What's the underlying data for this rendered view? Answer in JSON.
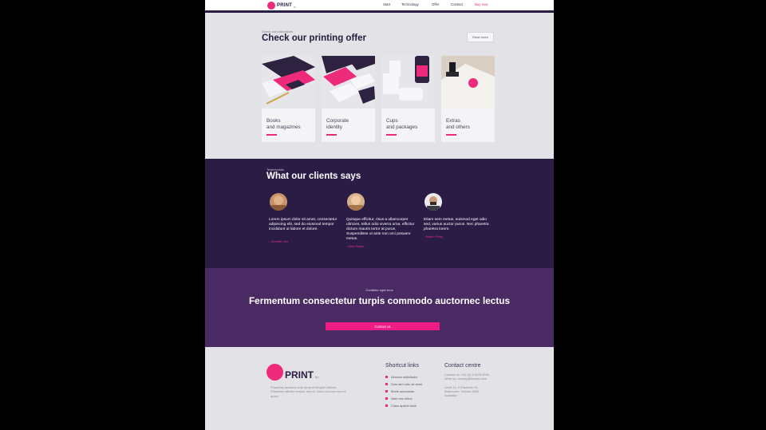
{
  "header": {
    "logo_text": "PRINT",
    "logo_sub": "8u",
    "nav": [
      {
        "label": "Start"
      },
      {
        "label": "Technology"
      },
      {
        "label": "Offer"
      },
      {
        "label": "Contact"
      },
      {
        "label": "Buy now"
      }
    ]
  },
  "offer": {
    "eyebrow": "Check our promotions",
    "title": "Check our printing offer",
    "read_more": "Read more",
    "cards": [
      {
        "label": "Books\nand magazines"
      },
      {
        "label": "Corporate\nidentity"
      },
      {
        "label": "Cups\nand packages"
      },
      {
        "label": "Extras\nand others"
      }
    ]
  },
  "testimonials": {
    "eyebrow": "Testimonials",
    "title": "What our clients says",
    "items": [
      {
        "quote": "Lorem ipsum dolor sit amet, consectetur adipiscing elit, sed do eiusmod tempor incididunt ut labore et dolore.",
        "author": "- Jennifer Lee"
      },
      {
        "quote": "Quisque efficitur, risus a ullamcorper ultricies, tellus odio viverra urna, efficitur dictum mauris tortor at purus. Suspendisse ut ante non orci posuere metus.",
        "author": "- Alice Bayer"
      },
      {
        "quote": "Etiam sem metus, euismod eget odio sed, varius auctor purus. Nec pharetra pharetra lorem.",
        "author": "- Martin Perry"
      }
    ]
  },
  "cta": {
    "eyebrow": "Curabitur eget eros",
    "title": "Fermentum consectetur turpis commodo auctornec lectus",
    "button": "Contact us"
  },
  "footer": {
    "logo_text": "PRINT",
    "logo_sub": "8u",
    "description": "Phasellus faucibus ante sit amet feugiat ultrices. Phasellus efficitur tempor rutrum. Nunc non orci nec ex quam.",
    "shortcut_title": "Shortcut links",
    "links": [
      {
        "label": "Aenean sollicitudin"
      },
      {
        "label": "Duis sed odio sit amet"
      },
      {
        "label": "Morbi accumsan"
      },
      {
        "label": "Nam nec tellus"
      },
      {
        "label": "Class aptent taciti"
      }
    ],
    "contact_title": "Contact centre",
    "contact_lines": "Contact us: +61 (0) 3 8376 6284\nWrite us: noreply@envato.com",
    "address": "Level 13, 2 Elizabeth St,\nMelbourne, Victoria 3000,\nAustralia"
  },
  "colors": {
    "accent": "#ee2b7b",
    "dark_purple": "#2a1c45",
    "cta_purple": "#4a2a63",
    "page_bg": "#e3e2e6"
  }
}
